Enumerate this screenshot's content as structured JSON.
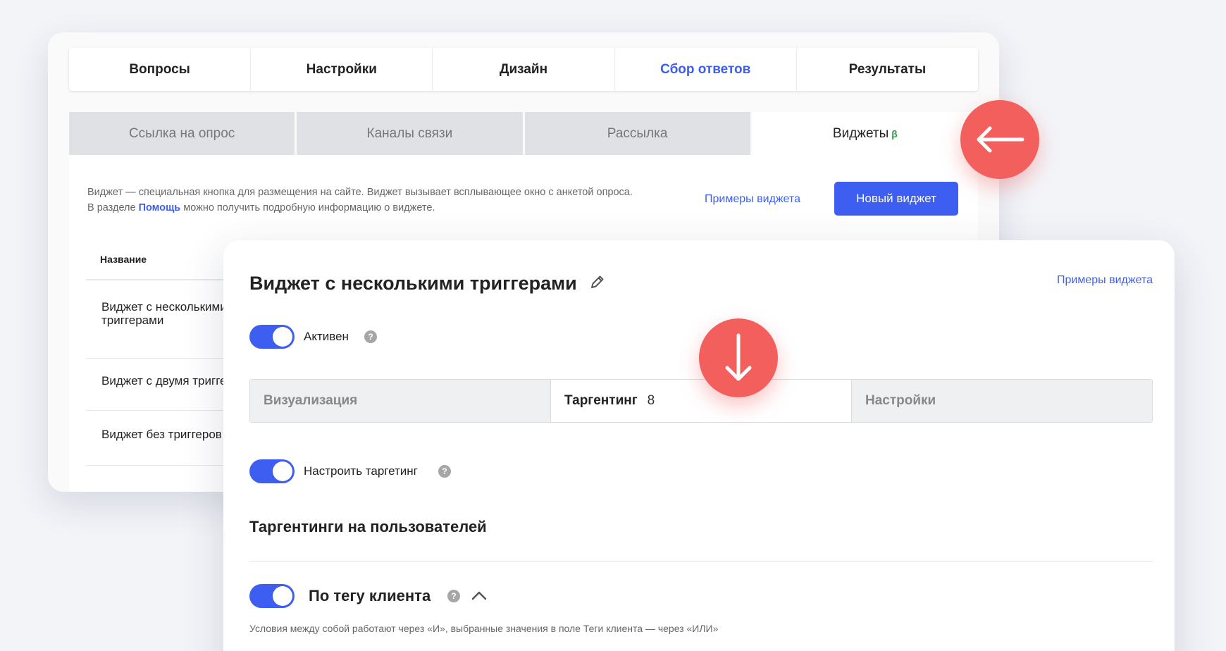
{
  "main_tabs": [
    "Вопросы",
    "Настройки",
    "Дизайн",
    "Сбор ответов",
    "Результаты"
  ],
  "sub_tabs": [
    "Ссылка на опрос",
    "Каналы связи",
    "Рассылка",
    "Виджеты"
  ],
  "beta_mark": "β",
  "description": {
    "line1": "Виджет — специальная кнопка для размещения на сайте. Виджет вызывает всплывающее окно с анкетой опроса.",
    "line2_pre": "В разделе ",
    "help_link": "Помощь",
    "line2_post": " можно получить подробную информацию о виджете."
  },
  "examples_link": "Примеры виджета",
  "new_widget_button": "Новый виджет",
  "table": {
    "header_name": "Название",
    "rows": [
      "Виджет с несколькими триггерами",
      "Виджет с двумя триггерами",
      "Виджет без триггеров"
    ]
  },
  "widget": {
    "title": "Виджет с несколькими триггерами",
    "examples_link": "Примеры виджета",
    "active_label": "Активен",
    "segments": [
      "Визуализация",
      "Таргентинг",
      "Настройки"
    ],
    "targeting_count": "8",
    "configure_targeting": "Настроить таргетинг",
    "section_title": "Таргентинги на пользователей",
    "tag_label": "По тегу клиента",
    "condition_text": "Условия между собой работают через «И», выбранные значения в поле Теги клиента — через «ИЛИ»"
  },
  "icons": {
    "help": "?",
    "arrow_left": "arrow-left-icon",
    "arrow_down": "arrow-down-icon",
    "pencil": "pencil-icon",
    "chevron_up": "chevron-up-icon"
  },
  "colors": {
    "accent": "#3d5ef0",
    "arrow_circle": "#f25f5c",
    "beta": "#2a9a4a"
  }
}
